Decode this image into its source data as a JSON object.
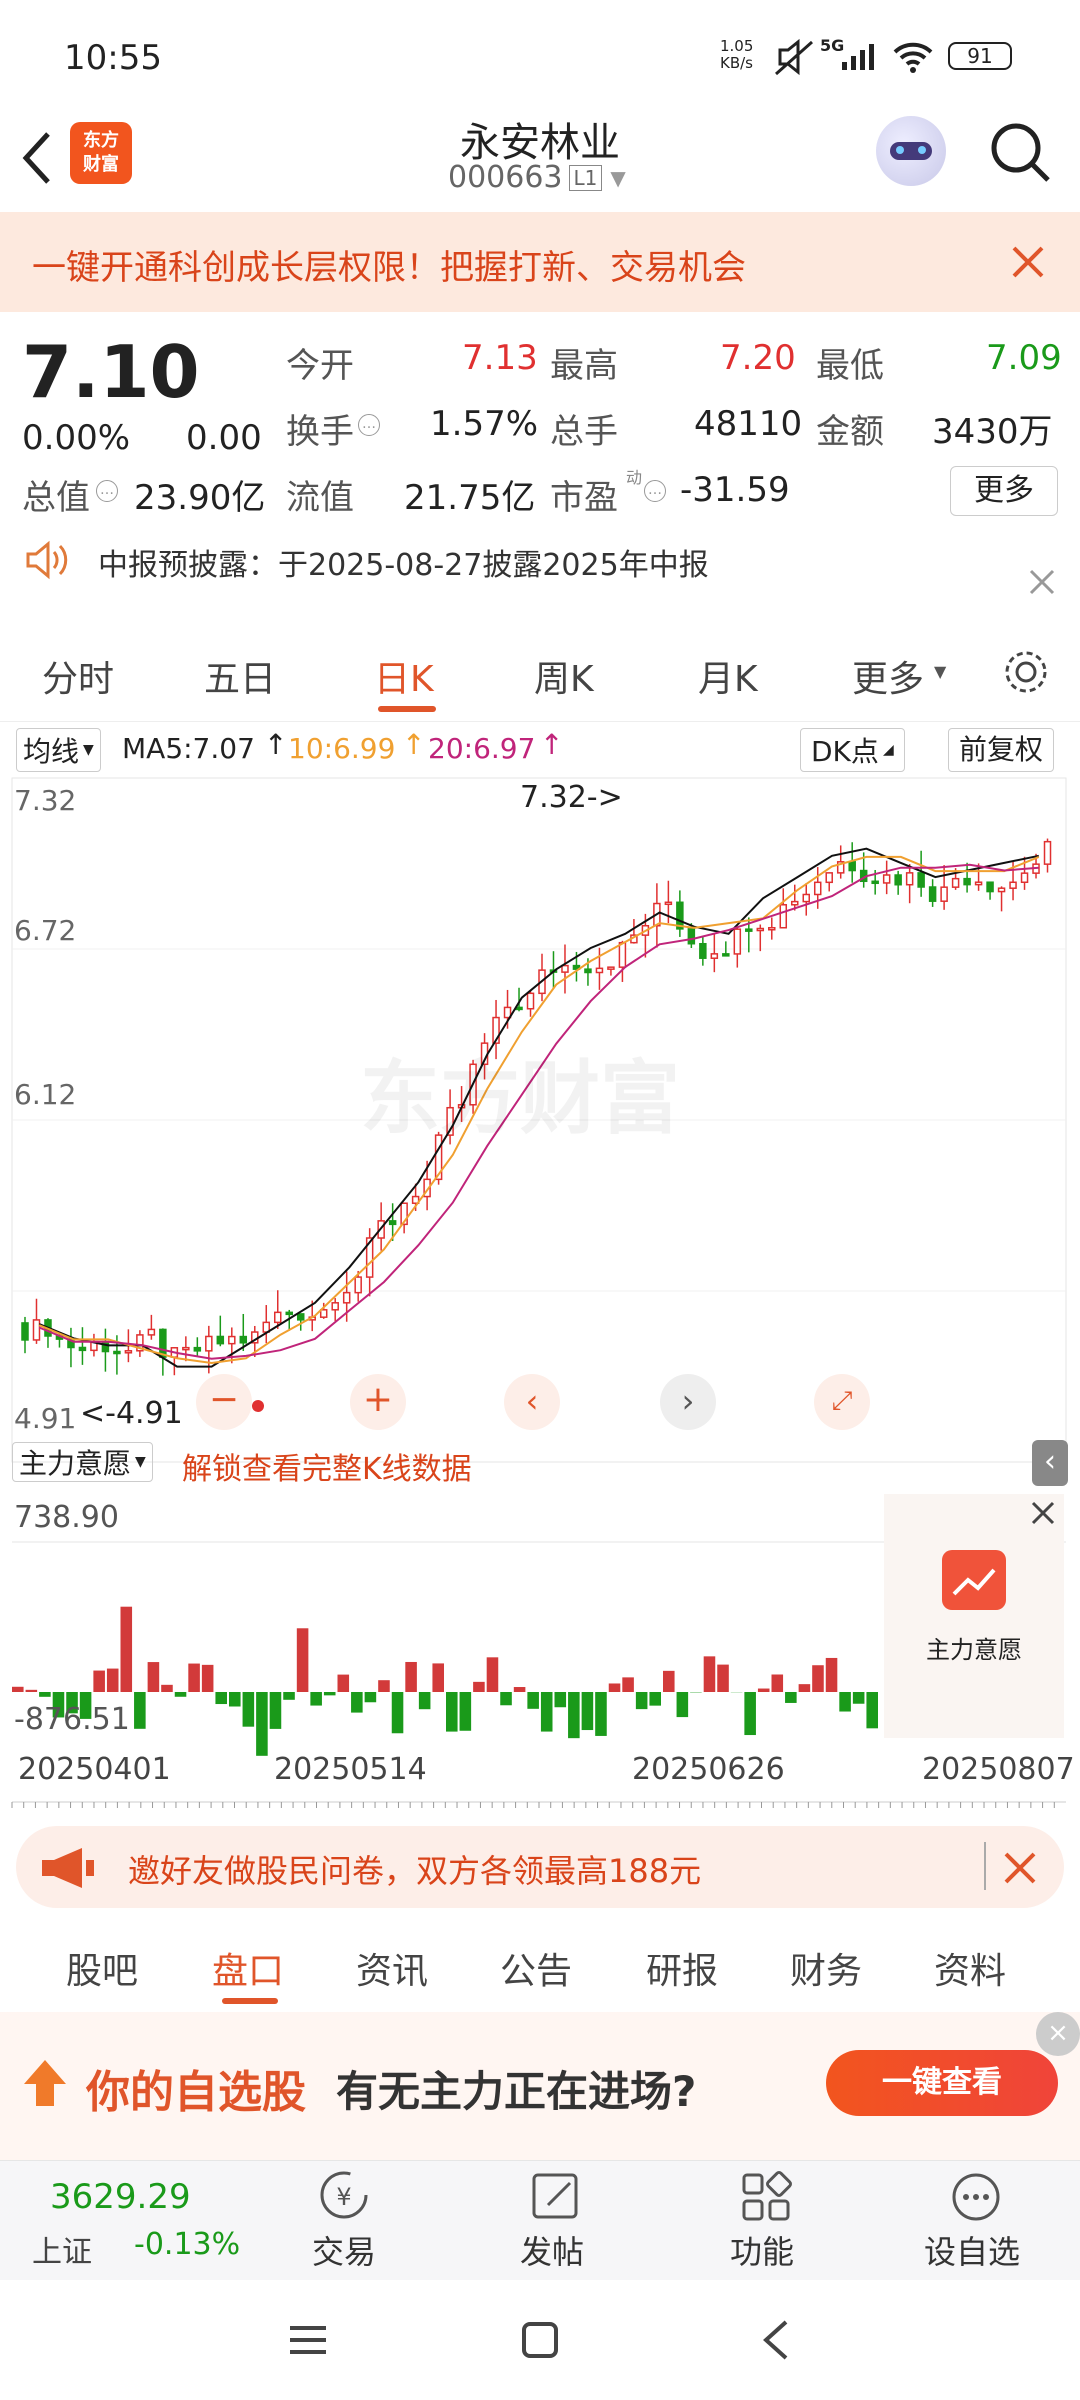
{
  "status": {
    "time": "10:55",
    "speed": "1.05\nKB/s",
    "net": "5G",
    "battery": "91"
  },
  "header": {
    "logo": "东方\n财富",
    "title": "永安林业",
    "code": "000663",
    "level": "L1"
  },
  "banner": {
    "text": "一键开通科创成长层权限！把握打新、交易机会"
  },
  "quote": {
    "price": "7.10",
    "pct": "0.00%",
    "chg": "0.00",
    "open_l": "今开",
    "open": "7.13",
    "high_l": "最高",
    "high": "7.20",
    "low_l": "最低",
    "low": "7.09",
    "turn_l": "换手",
    "turn": "1.57%",
    "vol_l": "总手",
    "vol": "48110",
    "amt_l": "金额",
    "amt": "3430万",
    "mcap_l": "总值",
    "mcap": "23.90亿",
    "float_l": "流值",
    "float": "21.75亿",
    "pe_l": "市盈",
    "pe_sup": "动",
    "pe": "-31.59",
    "more": "更多"
  },
  "notice": {
    "text": "中报预披露：于2025-08-27披露2025年中报"
  },
  "tabs": [
    "分时",
    "五日",
    "日K",
    "周K",
    "月K",
    "更多"
  ],
  "active_tab": "日K",
  "chart": {
    "ma_label": "均线",
    "ma5": "MA5:7.07",
    "ma10": "10:6.99",
    "ma20": "20:6.97",
    "dk": "DK点",
    "adj": "前复权",
    "y_top": "7.32",
    "y_mid": "6.72",
    "y_low": "6.12",
    "y_bot": "4.91",
    "max_note": "7.32->",
    "min_note": "<-4.91",
    "sub_label": "主力意愿",
    "unlock": "解锁查看完整K线数据",
    "sub_max": "738.90",
    "sub_min": "-876.51",
    "sub_btn": "主力意愿",
    "dates": [
      "20250401",
      "20250514",
      "20250626",
      "20250807"
    ],
    "watermark": "东方财富",
    "colors": {
      "up": "#e03030",
      "down": "#1a9a1a",
      "ma5": "#111111",
      "ma10": "#f0a030",
      "ma20": "#c0247a"
    }
  },
  "chart_data": {
    "type": "candlestick",
    "ylim": [
      4.91,
      7.32
    ],
    "max_value": 7.32,
    "min_value": 4.91,
    "ma": {
      "MA5": 7.07,
      "MA10": 6.99,
      "MA20": 6.97
    },
    "close_trend": [
      5.4,
      5.3,
      5.35,
      5.3,
      5.2,
      5.3,
      5.35,
      5.45,
      5.5,
      5.7,
      5.8,
      6.0,
      6.2,
      6.5,
      6.6,
      6.7,
      6.75,
      6.8,
      6.9,
      6.7,
      6.85,
      6.95,
      7.0,
      7.1,
      7.05,
      7.0,
      6.95,
      7.05,
      7.0,
      7.1
    ]
  },
  "promo": {
    "text": "邀好友做股民问卷，双方各领最高188元"
  },
  "bottom_tabs": [
    "股吧",
    "盘口",
    "资讯",
    "公告",
    "研报",
    "财务",
    "资料"
  ],
  "active_bottom": "盘口",
  "ad": {
    "text1": "你的自选股",
    "text2": "有无主力正在进场?",
    "btn": "一键查看"
  },
  "dock": {
    "index_val": "3629.29",
    "index_name": "上证",
    "index_pct": "-0.13%",
    "items": [
      "交易",
      "发帖",
      "功能",
      "设自选"
    ]
  }
}
